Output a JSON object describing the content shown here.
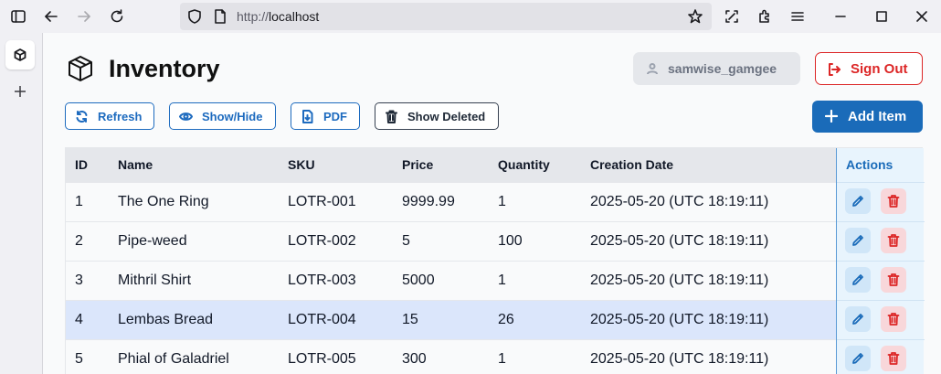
{
  "browser": {
    "url_scheme": "http://",
    "url_host": "localhost"
  },
  "page": {
    "title": "Inventory",
    "username": "samwise_gamgee",
    "signout_label": "Sign Out",
    "toolbar": {
      "refresh": "Refresh",
      "show_hide": "Show/Hide",
      "pdf": "PDF",
      "show_deleted": "Show Deleted",
      "add_item": "Add Item"
    }
  },
  "table": {
    "headers": [
      "ID",
      "Name",
      "SKU",
      "Price",
      "Quantity",
      "Creation Date"
    ],
    "actions_header": "Actions",
    "rows": [
      {
        "id": "1",
        "name": "The One Ring",
        "sku": "LOTR-001",
        "price": "9999.99",
        "quantity": "1",
        "created": "2025-05-20 (UTC 18:19:11)"
      },
      {
        "id": "2",
        "name": "Pipe-weed",
        "sku": "LOTR-002",
        "price": "5",
        "quantity": "100",
        "created": "2025-05-20 (UTC 18:19:11)"
      },
      {
        "id": "3",
        "name": "Mithril Shirt",
        "sku": "LOTR-003",
        "price": "5000",
        "quantity": "1",
        "created": "2025-05-20 (UTC 18:19:11)"
      },
      {
        "id": "4",
        "name": "Lembas Bread",
        "sku": "LOTR-004",
        "price": "15",
        "quantity": "26",
        "created": "2025-05-20 (UTC 18:19:11)",
        "selected": true
      },
      {
        "id": "5",
        "name": "Phial of Galadriel",
        "sku": "LOTR-005",
        "price": "300",
        "quantity": "1",
        "created": "2025-05-20 (UTC 18:19:11)"
      }
    ]
  },
  "colors": {
    "primary": "#1a6bb9",
    "danger": "#dc2626",
    "selected_row": "#dbe6fb"
  }
}
